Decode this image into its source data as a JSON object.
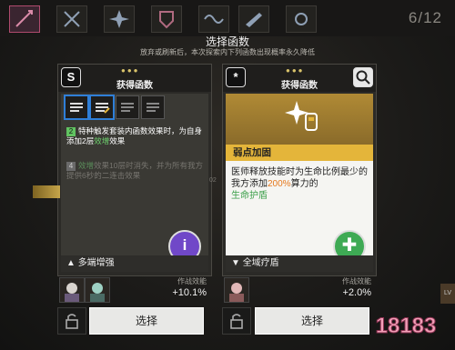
{
  "header": {
    "counter": "6/12",
    "title": "选择函数",
    "subtitle": "放弃或刷新后，本次探索内下列函数出现概率永久降低"
  },
  "left_card": {
    "icon": "S",
    "header_label": "获得函数",
    "effects": [
      {
        "num": "2",
        "text_before": "特种触发套装内函数效果时，为自身添加2层",
        "highlight": "效增",
        "text_after": "效果",
        "active": true
      },
      {
        "num": "4",
        "text_before": "",
        "highlight": "效增",
        "text_after": "效果10层时消失，并为所有我方提供6秒的二连击效果",
        "active": false
      }
    ],
    "set_name": "多端增强",
    "eff_label": "作战效能",
    "eff_value": "+10.1%",
    "select_label": "选择"
  },
  "right_card": {
    "icon": "*",
    "header_label": "获得函数",
    "function_name": "弱点加固",
    "desc_before": "医师释放技能时为生命比例最少的我方添加",
    "desc_pct": "200%",
    "desc_mid": "算力的",
    "desc_end": "生命护盾",
    "set_name": "全域疗盾",
    "eff_label": "作战效能",
    "eff_value": "+2.0%",
    "select_label": "选择"
  },
  "misc": {
    "side_text": "02",
    "lv": "LV",
    "watermark": "18183"
  },
  "colors": {
    "accent_gold": "#e4b53a",
    "highlight_green": "#6ed26e",
    "highlight_orange": "#e6791e",
    "fab_purple": "#7048c8",
    "fab_green": "#3eaa54"
  }
}
